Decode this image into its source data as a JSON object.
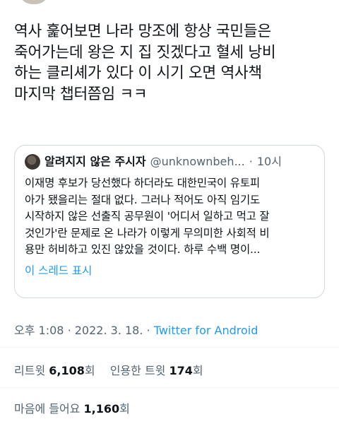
{
  "tweet": {
    "text": "역사 훑어보면 나라 망조에 항상 국민들은\n죽어가는데 왕은 지 집 짓겠다고 혈세 낭비\n하는 클리셰가 있다 이 시기 오면 역사책\n마지막 챕터쯤임 ㅋㅋ"
  },
  "quoted_tweet": {
    "author_name": "알려지지 않은 주시자",
    "author_handle": "@unknownbeh...",
    "separator": "·",
    "time": "10시",
    "text": "이재명 후보가 당선했다 하더라도 대한민국이 유토피\n아가 됐을리는 절대 없다. 그러나 적어도 아직 임기도\n시작하지 않은 선출직 공무원이 '어디서 일하고 먹고 잘\n것인가'란 문제로 온 나라가 이렇게 무의미한 사회적 비\n용만 허비하고 있진 않았을 것이다. 하루 수백 명이...",
    "show_thread_label": "이 스레드 표시"
  },
  "meta": {
    "time": "오후 1:08",
    "separator1": "·",
    "date": "2022. 3. 18.",
    "separator2": "·",
    "source": "Twitter for Android"
  },
  "stats": {
    "retweets_label": "리트윗",
    "retweets_count": "6,108",
    "retweets_unit": "회",
    "quotes_label": "인용한 트윗",
    "quotes_count": "174",
    "quotes_unit": "회",
    "likes_label": "마음에 들어요",
    "likes_count": "1,160",
    "likes_unit": "회"
  },
  "colors": {
    "link": "#1d9bf0",
    "secondary_text": "#536471",
    "border": "#cfd9de"
  }
}
